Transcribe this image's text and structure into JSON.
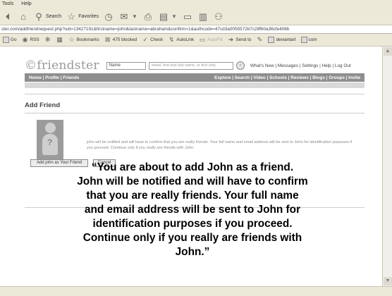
{
  "menubar": {
    "items": [
      "Tools",
      "Help"
    ]
  },
  "toolbar": {
    "search_label": "Search",
    "favorites_label": "Favorites"
  },
  "address": {
    "url": "ster.com/addfriendrequest.php?uid=13427191&firstname=john&lastname=abraham&confirm=1&authcode=47cd3a0055572b7c28f60a36cfe408b"
  },
  "linksbar": {
    "go_label": "Go",
    "rss_label": "RSS",
    "bookmarks_label": "Bookmarks",
    "blocked_label": "475 blocked",
    "check_label": "Check",
    "autolink_label": "AutoLink",
    "autofill_label": "AutoFill",
    "sendto_label": "Send to",
    "deviantart_label": "deviantart",
    "com_label": "com"
  },
  "site": {
    "logo": "friendster",
    "search_select": "Name",
    "search_placeholder": "email, first and last name, or first only",
    "top_links": "What's New | Messages | Settings | Help | Log Out",
    "nav_left": "Home | Profile | Friends",
    "nav_right": "Explore | Search | Video | Schools | Reviews | Blogs | Groups | Invite",
    "page_title": "Add Friend",
    "small_text": "john will be notified and will have to confirm that you are really friends. Your full name and email address will be sent to John for identification purposes if you proceed. Continue only if you really are friends with John.",
    "add_button": "Add john as Your Friend",
    "cancel_button": "Cancel"
  },
  "quote": {
    "line1": "“You are about to add John as a friend.",
    "line2": "John will be notified and will have to confirm",
    "line3": "that you are really friends. Your full name",
    "line4": "and email address will be sent to John for",
    "line5": "identification purposes if you proceed.",
    "line6": "Continue only if you really are friends with",
    "line7": "John.”"
  }
}
